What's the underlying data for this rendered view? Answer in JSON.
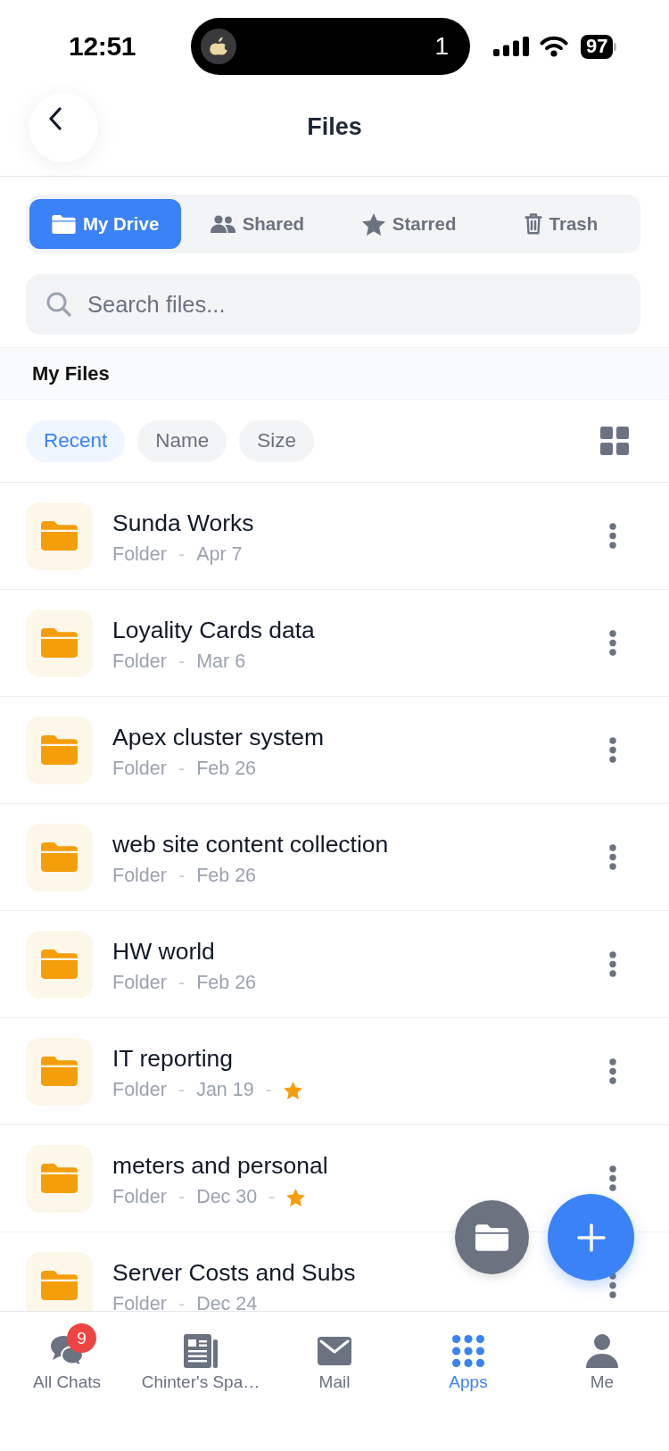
{
  "status_bar": {
    "time": "12:51",
    "island_count": "1",
    "battery": "97"
  },
  "header": {
    "title": "Files"
  },
  "tabs": [
    {
      "label": "My Drive",
      "kind": "drive",
      "selected": true
    },
    {
      "label": "Shared",
      "kind": "shared",
      "selected": false
    },
    {
      "label": "Starred",
      "kind": "starred",
      "selected": false
    },
    {
      "label": "Trash",
      "kind": "trash",
      "selected": false
    }
  ],
  "search": {
    "placeholder": "Search files..."
  },
  "section": {
    "title": "My Files"
  },
  "sort_options": [
    {
      "label": "Recent",
      "selected": true
    },
    {
      "label": "Name",
      "selected": false
    },
    {
      "label": "Size",
      "selected": false
    }
  ],
  "files": [
    {
      "name": "Sunda Works",
      "type": "Folder",
      "separators": [
        "-"
      ],
      "date": "Apr 7",
      "starred": false
    },
    {
      "name": "Loyality Cards data",
      "type": "Folder",
      "separators": [
        "-"
      ],
      "date": "Mar 6",
      "starred": false
    },
    {
      "name": "Apex cluster system",
      "type": "Folder",
      "separators": [
        "-"
      ],
      "date": "Feb 26",
      "starred": false
    },
    {
      "name": "web site content collection",
      "type": "Folder",
      "separators": [
        "-"
      ],
      "date": "Feb 26",
      "starred": false
    },
    {
      "name": "HW world",
      "type": "Folder",
      "separators": [
        "-"
      ],
      "date": "Feb 26",
      "starred": false
    },
    {
      "name": "IT reporting",
      "type": "Folder",
      "separators": [
        "-",
        "-"
      ],
      "date": "Jan 19",
      "starred": true
    },
    {
      "name": "meters and personal",
      "type": "Folder",
      "separators": [
        "-",
        "-"
      ],
      "date": "Dec 30",
      "starred": true
    },
    {
      "name": "Server Costs and Subs",
      "type": "Folder",
      "separators": [
        "-"
      ],
      "date": "Dec 24",
      "starred": false
    }
  ],
  "bottom_nav": [
    {
      "label": "All Chats",
      "kind": "chats",
      "badge": "9",
      "selected": false
    },
    {
      "label": "Chinter's Spa…",
      "kind": "space",
      "selected": false
    },
    {
      "label": "Mail",
      "kind": "mail",
      "selected": false
    },
    {
      "label": "Apps",
      "kind": "apps",
      "selected": true
    },
    {
      "label": "Me",
      "kind": "profile",
      "selected": false
    }
  ]
}
